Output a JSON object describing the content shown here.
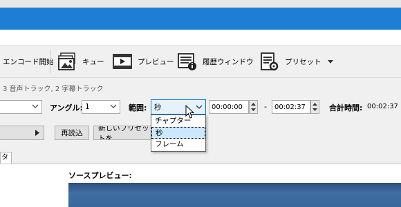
{
  "toolbar": {
    "encode_label": "エンコード開始",
    "queue_label": "キュー",
    "preview_label": "プレビュー",
    "history_label": "履歴ウィンドウ",
    "preset_label": "プリセット"
  },
  "source": {
    "info": "3 音声トラック, 2 字幕トラック"
  },
  "controls": {
    "angle_label": "アングル:",
    "angle_value": "1",
    "range_label": "範囲:",
    "range_value": "秒",
    "range_options": [
      "チャプター",
      "秒",
      "フレーム"
    ],
    "start_time": "00:00:00",
    "dash": "-",
    "end_time": "00:02:37",
    "total_label": "合計時間:",
    "total_value": "00:02:37"
  },
  "buttons": {
    "reload_label": "再読込",
    "new_preset_label": "新しいプリセットを"
  },
  "tabs": {
    "partial_tab": "ター"
  },
  "preview": {
    "label": "ソースプレビュー:"
  },
  "colors": {
    "accent_blue": "#1c7fd4",
    "selection": "#cce8ff"
  }
}
